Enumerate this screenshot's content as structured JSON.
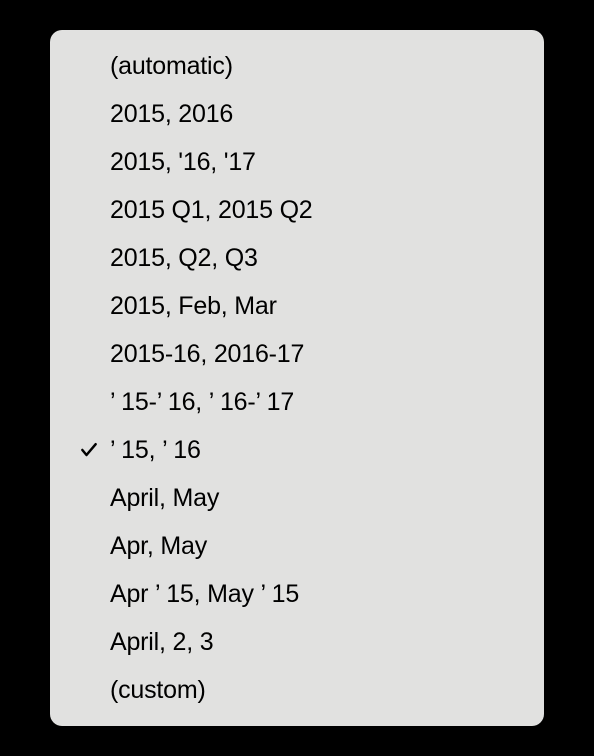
{
  "menu": {
    "items": [
      {
        "label": "(automatic)",
        "selected": false
      },
      {
        "label": "2015, 2016",
        "selected": false
      },
      {
        "label": "2015, '16, '17",
        "selected": false
      },
      {
        "label": "2015 Q1, 2015 Q2",
        "selected": false
      },
      {
        "label": "2015, Q2, Q3",
        "selected": false
      },
      {
        "label": "2015, Feb, Mar",
        "selected": false
      },
      {
        "label": "2015-16, 2016-17",
        "selected": false
      },
      {
        "label": "’ 15-’ 16, ’ 16-’ 17",
        "selected": false
      },
      {
        "label": "’ 15, ’ 16",
        "selected": true
      },
      {
        "label": "April, May",
        "selected": false
      },
      {
        "label": "Apr, May",
        "selected": false
      },
      {
        "label": "Apr ’ 15, May ’ 15",
        "selected": false
      },
      {
        "label": "April, 2, 3",
        "selected": false
      },
      {
        "label": "(custom)",
        "selected": false
      }
    ]
  }
}
